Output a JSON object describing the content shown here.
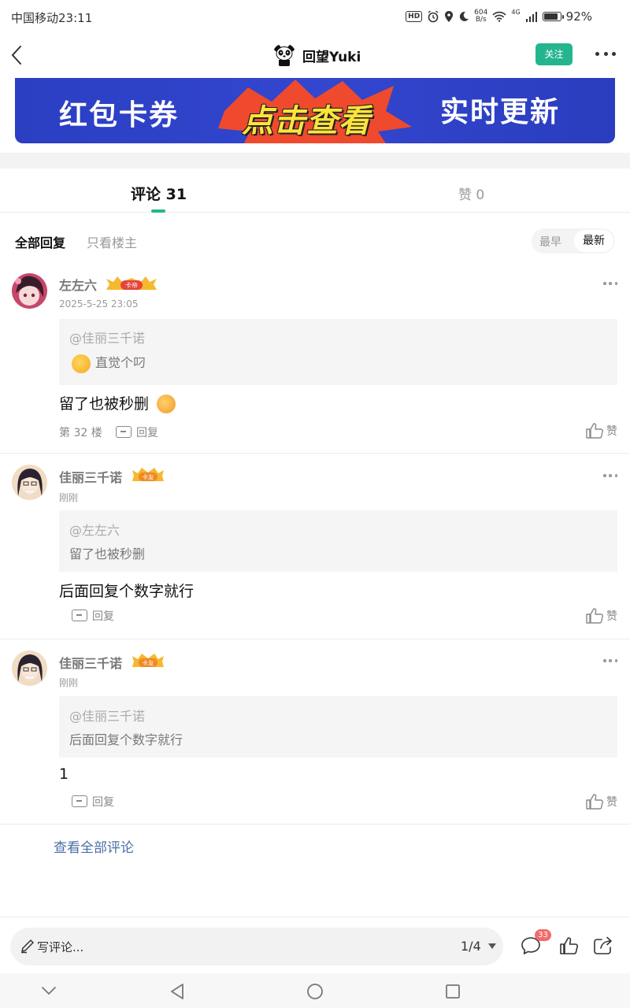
{
  "status_bar": {
    "carrier": "中国移动",
    "time": "23:11",
    "hd": "HD",
    "speed_value": "604",
    "speed_unit": "B/s",
    "network": "4G",
    "battery": "92%",
    "battery_level": 0.92
  },
  "nav": {
    "title": "回望Yuki",
    "follow_label": "关注"
  },
  "banner": {
    "left_text": "红包卡券",
    "middle_text": "点击查看",
    "right_text": "实时更新"
  },
  "tabs": {
    "comments_label": "评论 31",
    "likes_label": "赞 0"
  },
  "filters": {
    "all_replies": "全部回复",
    "op_only": "只看楼主",
    "sort_earliest": "最早",
    "sort_newest": "最新"
  },
  "comments": [
    {
      "user": "左左六",
      "badge": "卡帝",
      "time": "2025-5-25 23:05",
      "quote_at": "@佳丽三千诺",
      "quote_text": "直觉个叼",
      "body": "留了也被秒删",
      "floor": "第 32 楼",
      "reply_label": "回复",
      "like_label": "赞"
    },
    {
      "user": "佳丽三千诺",
      "badge": "卡友",
      "time": "刚刚",
      "quote_at": "@左左六",
      "quote_text": "留了也被秒删",
      "body": "后面回复个数字就行",
      "reply_label": "回复",
      "like_label": "赞"
    },
    {
      "user": "佳丽三千诺",
      "badge": "卡友",
      "time": "刚刚",
      "quote_at": "@佳丽三千诺",
      "quote_text": "后面回复个数字就行",
      "body": "1",
      "reply_label": "回复",
      "like_label": "赞"
    }
  ],
  "view_all": "查看全部评论",
  "bottom_bar": {
    "write_placeholder": "写评论...",
    "page_indicator": "1/4",
    "comment_count": "33"
  },
  "colors": {
    "accent": "#25b58e",
    "banner_blue": "#2f43c9",
    "badge_red": "#f26b6b",
    "link_blue": "#4a6fa5"
  }
}
